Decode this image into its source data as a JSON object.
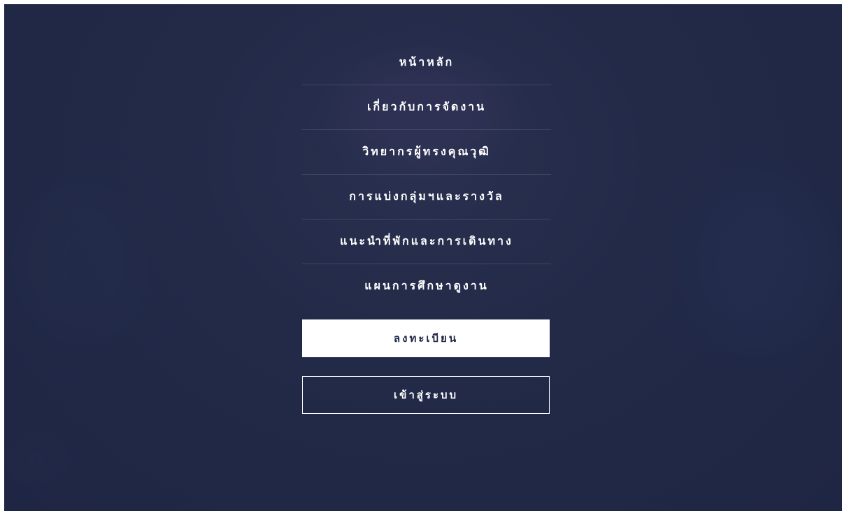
{
  "menu": {
    "items": [
      {
        "label": "หน้าหลัก"
      },
      {
        "label": "เกี่ยวกับการจัดงาน"
      },
      {
        "label": "วิทยากรผู้ทรงคุณวุฒิ"
      },
      {
        "label": "การแบ่งกลุ่มฯและรางวัล"
      },
      {
        "label": "แนะนำที่พักและการเดินทาง"
      },
      {
        "label": "แผนการศึกษาดูงาน"
      }
    ]
  },
  "actions": {
    "register_label": "ลงทะเบียน",
    "login_label": "เข้าสู่ระบบ"
  },
  "colors": {
    "overlay_bg": "#222a48",
    "text": "#ffffff"
  }
}
